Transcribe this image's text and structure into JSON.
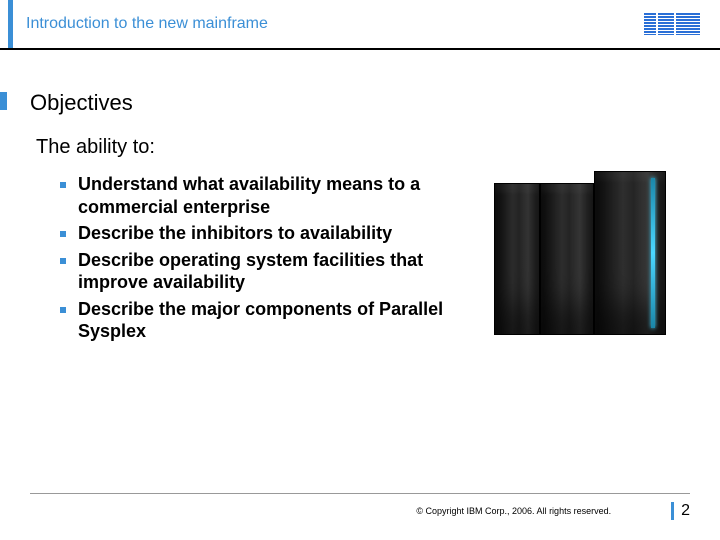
{
  "header": {
    "title": "Introduction to the new mainframe",
    "logo_name": "IBM"
  },
  "slide": {
    "title": "Objectives",
    "subtitle": "The ability to:",
    "bullets": [
      "Understand what availability means to a commercial enterprise",
      "Describe the inhibitors to availability",
      "Describe operating system facilities that improve availability",
      "Describe the major components of Parallel Sysplex"
    ],
    "image_alt": "IBM mainframe hardware"
  },
  "footer": {
    "copyright": "© Copyright IBM Corp., 2006. All rights reserved.",
    "page": "2"
  },
  "colors": {
    "accent": "#3b8fd6"
  }
}
